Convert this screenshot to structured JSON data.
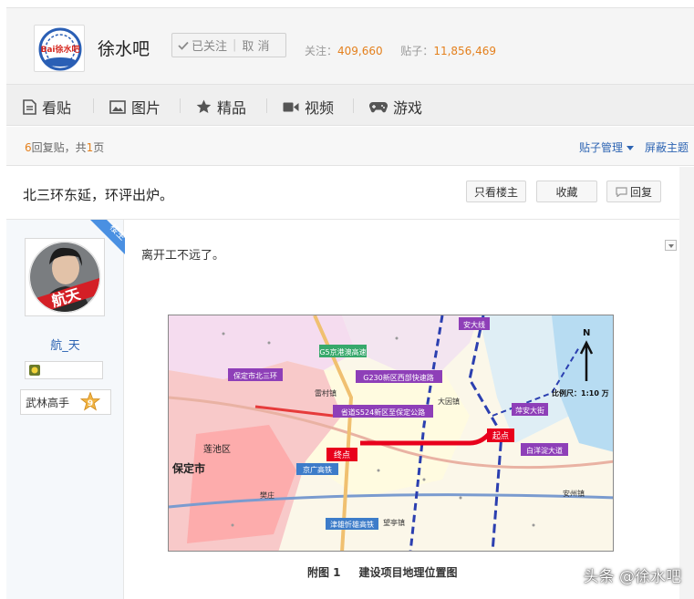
{
  "header": {
    "logo_text": "Bai徐水吧",
    "forum_name": "徐水吧",
    "follow_label": "已关注",
    "unfollow_label": "取 消",
    "stats_follow_label": "关注：",
    "stats_follow_value": "409,660",
    "stats_posts_label": "贴子：",
    "stats_posts_value": "11,856,469"
  },
  "nav": {
    "tabs": [
      {
        "label": "看贴",
        "icon": "document-icon"
      },
      {
        "label": "图片",
        "icon": "image-icon"
      },
      {
        "label": "精品",
        "icon": "star-icon"
      },
      {
        "label": "视频",
        "icon": "video-icon"
      },
      {
        "label": "游戏",
        "icon": "gamepad-icon"
      }
    ]
  },
  "thread_bar": {
    "reply_count": "6",
    "reply_mid": "回复贴，共",
    "page_count": "1",
    "page_suffix": "页",
    "manage_label": "贴子管理",
    "block_label": "屏蔽主题"
  },
  "post_header": {
    "title": "北三环东延，环评出炉。",
    "only_op_label": "只看楼主",
    "favorite_label": "收藏",
    "reply_label": "回复"
  },
  "author": {
    "corner_label": "楼主",
    "avatar_text": "航天",
    "name": "航_天",
    "level_title": "武林高手",
    "level_num": "9"
  },
  "post": {
    "text": "离开工不远了。",
    "caption_num": "附图 1",
    "caption_text": "建设项目地理位置图"
  },
  "map": {
    "labels": {
      "north": "N",
      "scale": "比例尺：1:10 万",
      "road_s524": "省道S524新区至保定公路",
      "g5": "G5京港澳高速",
      "g230": "G230新区西部快速路",
      "beisanhuan": "保定市北三环",
      "anda": "安大线",
      "pingan": "萍安大街",
      "baiyangdian": "白洋淀大道",
      "start": "起点",
      "end": "终点",
      "city": "保定市",
      "lianchi": "莲池区",
      "jingguang": "京广高铁",
      "jingxiong": "津雄忻雄高铁",
      "anzhou": "安州镇",
      "damao": "大因镇",
      "leicun": "雷村镇",
      "fanzhuang": "樊庄",
      "wangting": "望亭镇"
    }
  },
  "watermark": "头条 @徐水吧",
  "colors": {
    "accent_orange": "#e4801d",
    "link_blue": "#2d64b3",
    "route_red": "#e8001c",
    "corner_blue": "#4a90e2"
  }
}
